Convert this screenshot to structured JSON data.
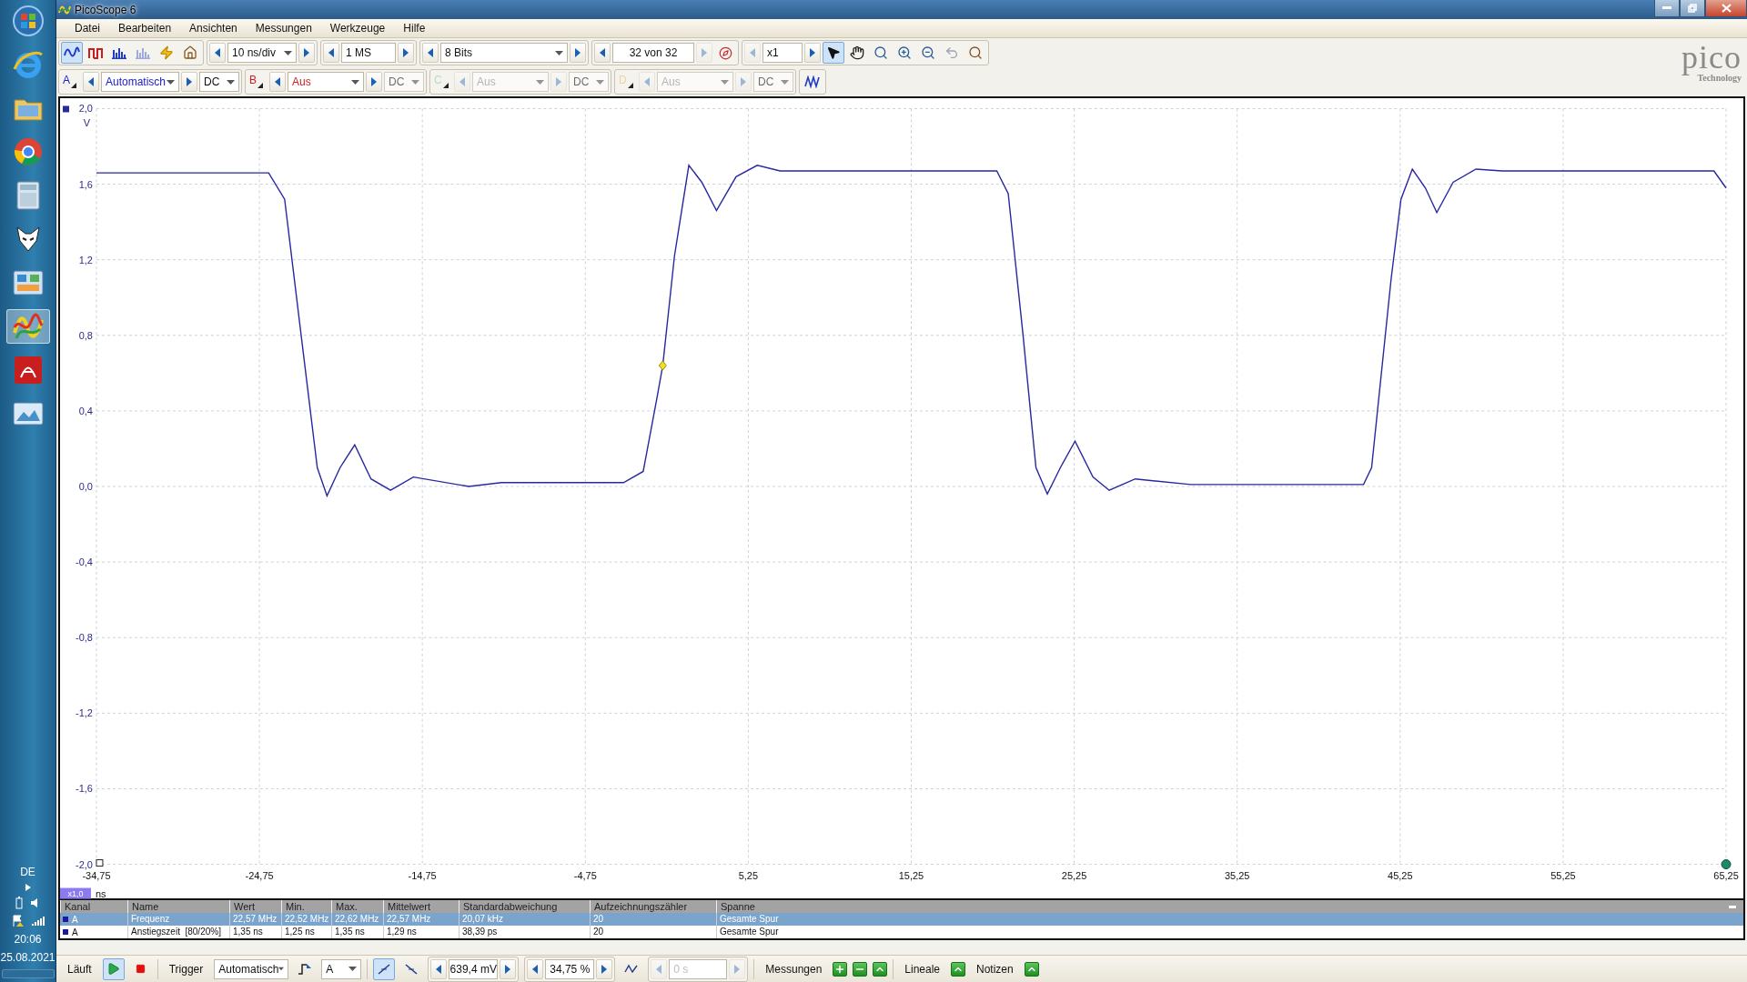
{
  "window": {
    "title": "PicoScope 6"
  },
  "menu": [
    "Datei",
    "Bearbeiten",
    "Ansichten",
    "Messungen",
    "Werkzeuge",
    "Hilfe"
  ],
  "toolbar": {
    "modes": [
      {
        "kind": "scope",
        "selected": true,
        "disabled": false
      },
      {
        "kind": "persistence",
        "selected": false,
        "disabled": false
      },
      {
        "kind": "spectrum",
        "selected": false,
        "disabled": false
      },
      {
        "kind": "spectrum",
        "selected": false,
        "disabled": true
      }
    ],
    "timebase": "10 ns/div",
    "samples": "1 MS",
    "resolution": "8 Bits",
    "buffer": "32 von 32",
    "zoom": "x1",
    "tools": [
      {
        "kind": "pointer",
        "selected": true
      },
      {
        "kind": "hand",
        "selected": false
      },
      {
        "kind": "zoom-area",
        "selected": false
      },
      {
        "kind": "zoom-in",
        "selected": false
      },
      {
        "kind": "zoom-out",
        "selected": false
      },
      {
        "kind": "undo",
        "selected": false
      }
    ]
  },
  "channels": [
    {
      "label": "A",
      "range": "Automatisch",
      "coupling": "DC",
      "disabled": false,
      "coupling_disabled": false,
      "color": "#1a1acc"
    },
    {
      "label": "B",
      "range": "Aus",
      "coupling": "DC",
      "disabled": false,
      "coupling_disabled": true,
      "color": "#cc2020"
    },
    {
      "label": "C",
      "range": "Aus",
      "coupling": "DC",
      "disabled": true,
      "coupling_disabled": true,
      "color": "#b4dcc0"
    },
    {
      "label": "D",
      "range": "Aus",
      "coupling": "DC",
      "disabled": true,
      "coupling_disabled": true,
      "color": "#e6d6a0"
    }
  ],
  "logo": {
    "name": "pico",
    "tagline": "Technology"
  },
  "plot": {
    "scale_badge": "x1,0",
    "chart_data": {
      "type": "line",
      "xlabel": "ns",
      "ylabel": "V",
      "x": [
        -34.75,
        -24.18,
        -23.2,
        -22.2,
        -21.2,
        -20.6,
        -19.8,
        -18.9,
        -17.9,
        -16.7,
        -15.3,
        -11.9,
        -9.9,
        -2.4,
        -1.2,
        -0.37,
        0,
        0.72,
        1.6,
        2.4,
        3.3,
        4.5,
        5.8,
        7.2,
        20.5,
        21.2,
        22.1,
        22.9,
        23.6,
        24.4,
        25.3,
        26.4,
        27.4,
        29.0,
        32.4,
        43.0,
        43.5,
        44.7,
        45.3,
        46.0,
        46.8,
        47.5,
        48.5,
        49.9,
        51.5,
        64.5,
        65.25
      ],
      "series": [
        {
          "color": "#2828a0",
          "values": [
            1.66,
            1.66,
            1.52,
            0.81,
            0.1,
            -0.05,
            0.1,
            0.22,
            0.04,
            -0.02,
            0.05,
            0.0,
            0.02,
            0.02,
            0.08,
            0.46,
            0.64,
            1.22,
            1.7,
            1.61,
            1.46,
            1.64,
            1.7,
            1.67,
            1.67,
            1.55,
            0.81,
            0.1,
            -0.04,
            0.1,
            0.24,
            0.05,
            -0.02,
            0.04,
            0.01,
            0.01,
            0.1,
            1.1,
            1.52,
            1.68,
            1.58,
            1.45,
            1.61,
            1.68,
            1.67,
            1.67,
            1.58
          ]
        }
      ],
      "xlim": [
        -34.75,
        65.25
      ],
      "ylim": [
        -2,
        2
      ],
      "grid": true,
      "xticks": [
        {
          "value": -34.75,
          "label": "-34,75"
        },
        {
          "value": -24.75,
          "label": "-24,75"
        },
        {
          "value": -14.75,
          "label": "-14,75"
        },
        {
          "value": -4.75,
          "label": "-4,75"
        },
        {
          "value": 5.25,
          "label": "5,25"
        },
        {
          "value": 15.25,
          "label": "15,25"
        },
        {
          "value": 25.25,
          "label": "25,25"
        },
        {
          "value": 35.25,
          "label": "35,25"
        },
        {
          "value": 45.25,
          "label": "45,25"
        },
        {
          "value": 55.25,
          "label": "55,25"
        },
        {
          "value": 65.25,
          "label": "65,25"
        }
      ],
      "yticks": [
        {
          "value": 2,
          "label": "2,0"
        },
        {
          "value": 1.6,
          "label": "1,6"
        },
        {
          "value": 1.2,
          "label": "1,2"
        },
        {
          "value": 0.8,
          "label": "0,8"
        },
        {
          "value": 0.4,
          "label": "0,4"
        },
        {
          "value": 0,
          "label": "0,0"
        },
        {
          "value": -0.4,
          "label": "-0,4"
        },
        {
          "value": -0.8,
          "label": "-0,8"
        },
        {
          "value": -1.2,
          "label": "-1,2"
        },
        {
          "value": -1.6,
          "label": "-1,6"
        },
        {
          "value": -2,
          "label": "-2,0"
        }
      ]
    }
  },
  "measurements": {
    "columns": [
      "Kanal",
      "Name",
      "Wert",
      "Min.",
      "Max.",
      "Mittelwert",
      "Standardabweichung",
      "Aufzeichnungszähler",
      "Spanne"
    ],
    "rows": [
      {
        "selected": true,
        "color": "#1a1a9a",
        "cells": [
          "A",
          "Frequenz",
          "22,57 MHz",
          "22,52 MHz",
          "22,62 MHz",
          "22,57 MHz",
          "20,07 kHz",
          "20",
          "Gesamte Spur"
        ]
      },
      {
        "selected": false,
        "color": "#1a1a9a",
        "cells": [
          "A",
          "Anstiegszeit  [80/20%]",
          "1,35 ns",
          "1,25 ns",
          "1,35 ns",
          "1,29 ns",
          "38,39 ps",
          "20",
          "Gesamte Spur"
        ]
      }
    ]
  },
  "statusbar": {
    "state": "Läuft",
    "running": true,
    "trigger_label": "Trigger",
    "trigger_mode": "Automatisch",
    "trigger_source": "A",
    "edges": [
      {
        "kind": "rising",
        "selected": true
      },
      {
        "kind": "falling",
        "selected": false
      }
    ],
    "threshold": "639,4 mV",
    "pretrigger": "34,75 %",
    "delay": "0 s",
    "delay_disabled": true,
    "measurements_label": "Messungen",
    "rulers_label": "Lineale",
    "notes_label": "Notizen"
  },
  "taskbar": {
    "language": "DE",
    "time": "20:06",
    "date": "25.08.2021"
  }
}
